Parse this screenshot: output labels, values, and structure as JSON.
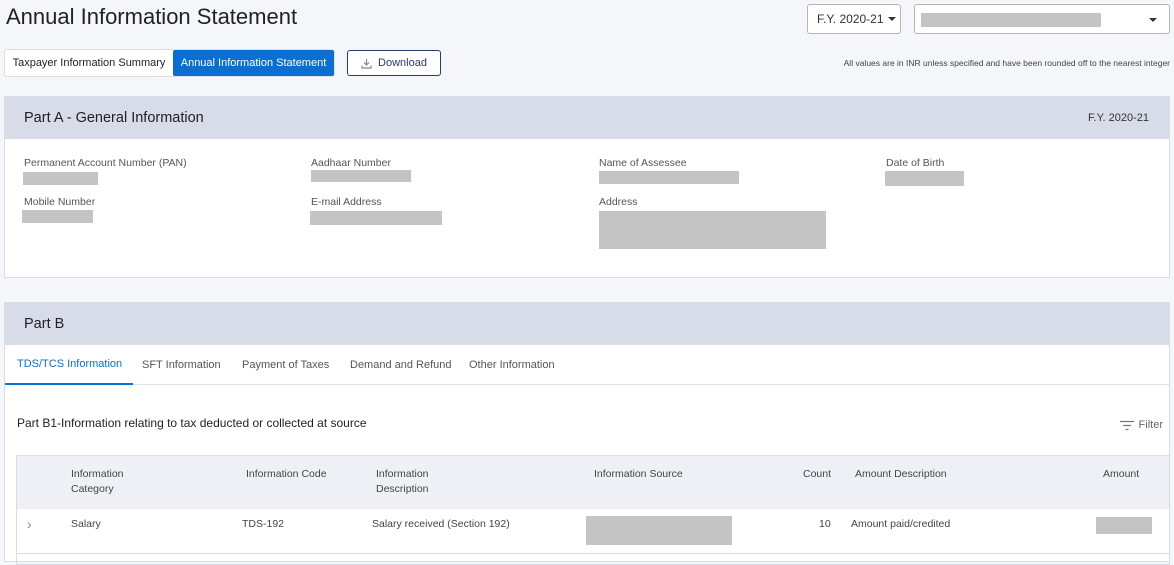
{
  "page": {
    "title": "Annual Information Statement",
    "fy_select": "F.Y. 2020-21",
    "user_select_value": "",
    "view_toggle": [
      "Taxpayer Information Summary",
      "Annual Information Statement"
    ],
    "active_view": "Annual Information Statement",
    "download_label": "Download",
    "note": "All values are in INR unless specified and have been rounded off to the nearest integer"
  },
  "part_a": {
    "title": "Part A - General Information",
    "fy": "F.Y. 2020-21",
    "fields": [
      {
        "label": "Permanent Account Number (PAN)",
        "value": ""
      },
      {
        "label": "Aadhaar Number",
        "value": ""
      },
      {
        "label": "Name of Assessee",
        "value": ""
      },
      {
        "label": "Date of Birth",
        "value": ""
      },
      {
        "label": "Mobile Number",
        "value": ""
      },
      {
        "label": "E-mail Address",
        "value": ""
      },
      {
        "label": "Address",
        "value": ""
      }
    ]
  },
  "part_b": {
    "title": "Part B",
    "tabs": [
      "TDS/TCS Information",
      "SFT Information",
      "Payment of Taxes",
      "Demand and Refund",
      "Other Information"
    ],
    "active_tab": "TDS/TCS Information",
    "section_title": "Part B1-Information relating to tax deducted or collected at source",
    "filter_label": "Filter",
    "table": {
      "headers": [
        "Information Category",
        "Information Code",
        "Information Description",
        "Information Source",
        "Count",
        "Amount Description",
        "Amount"
      ],
      "rows": [
        {
          "category": "Salary",
          "code": "TDS-192",
          "description": "Salary received (Section 192)",
          "source": "",
          "count": "10",
          "amount_description": "Amount paid/credited",
          "amount": ""
        }
      ]
    }
  }
}
